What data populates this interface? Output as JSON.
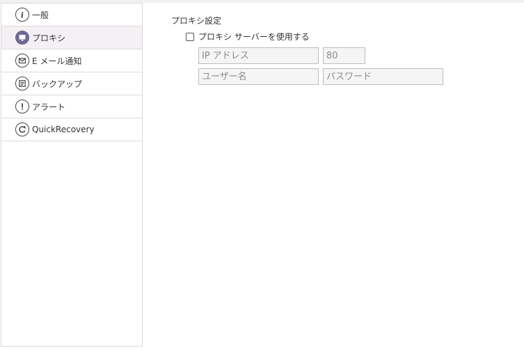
{
  "sidebar": {
    "items": [
      {
        "label": "一般",
        "icon": "info-icon"
      },
      {
        "label": "プロキシ",
        "icon": "monitor-icon"
      },
      {
        "label": "E メール通知",
        "icon": "mail-icon"
      },
      {
        "label": "バックアップ",
        "icon": "list-icon"
      },
      {
        "label": "アラート",
        "icon": "alert-icon"
      },
      {
        "label": "QuickRecovery",
        "icon": "refresh-icon"
      }
    ],
    "active_index": 1
  },
  "proxy": {
    "section_title": "プロキシ設定",
    "use_proxy_label": "プロキシ サーバーを使用する",
    "use_proxy_checked": false,
    "ip_address": {
      "value": "",
      "placeholder": "IP アドレス"
    },
    "port": {
      "value": "80",
      "placeholder": ""
    },
    "username": {
      "value": "",
      "placeholder": "ユーザー名"
    },
    "password": {
      "value": "",
      "placeholder": "パスワード"
    }
  },
  "colors": {
    "active_item_bg": "#f4f0f4",
    "active_icon_fill": "#6f6a93",
    "field_bg": "#f5f5f5",
    "border": "#d9d9d9"
  }
}
